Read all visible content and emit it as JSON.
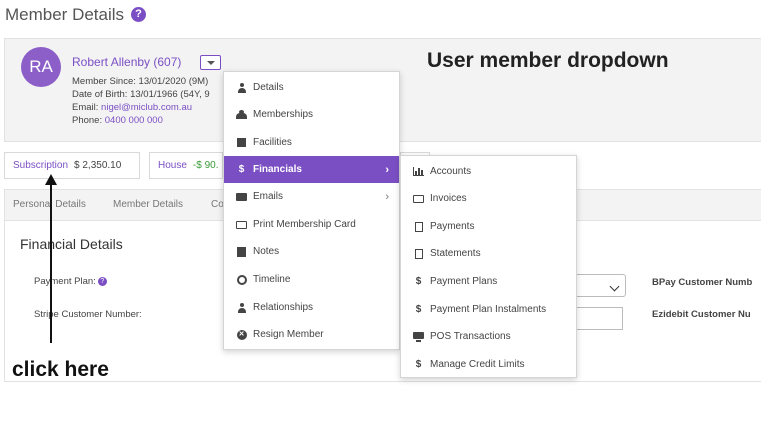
{
  "page": {
    "title": "Member Details",
    "help_glyph": "?"
  },
  "member": {
    "initials": "RA",
    "name": "Robert Allenby (607)",
    "since_label": "Member Since:",
    "since_value": "13/01/2020 (9M)",
    "dob_label": "Date of Birth:",
    "dob_value": "13/01/1966 (54Y, 9",
    "email_label": "Email:",
    "email_value": "nigel@miclub.com.au",
    "phone_label": "Phone:",
    "phone_value": "0400 000 000"
  },
  "annotations": {
    "dropdown_caption": "User member dropdown",
    "click_caption": "click here"
  },
  "balances": [
    {
      "label": "Subscription",
      "amount": "$ 2,350.10"
    },
    {
      "label": "House",
      "amount": "-$ 90."
    }
  ],
  "tabs": [
    "Personal Details",
    "Member Details",
    "Co"
  ],
  "financial": {
    "title": "Financial Details",
    "payment_plan_label": "Payment Plan:",
    "stripe_label": "Stripe Customer Number:",
    "bpay_label": "BPay Customer Numb",
    "ezidebit_label": "Ezidebit Customer Nu"
  },
  "main_menu": [
    {
      "label": "Details",
      "icon": "person-icon"
    },
    {
      "label": "Memberships",
      "icon": "group-icon"
    },
    {
      "label": "Facilities",
      "icon": "puzzle-icon"
    },
    {
      "label": "Financials",
      "icon": "dollar-icon",
      "active": true,
      "submenu": true
    },
    {
      "label": "Emails",
      "icon": "envelope-icon",
      "submenu": true
    },
    {
      "label": "Print Membership Card",
      "icon": "card-icon"
    },
    {
      "label": "Notes",
      "icon": "note-icon"
    },
    {
      "label": "Timeline",
      "icon": "clock-icon"
    },
    {
      "label": "Relationships",
      "icon": "person-icon"
    },
    {
      "label": "Resign Member",
      "icon": "x-circle-icon"
    }
  ],
  "sub_menu": [
    {
      "label": "Accounts",
      "icon": "bar-chart-icon"
    },
    {
      "label": "Invoices",
      "icon": "card-icon"
    },
    {
      "label": "Payments",
      "icon": "document-icon"
    },
    {
      "label": "Statements",
      "icon": "document-icon"
    },
    {
      "label": "Payment Plans",
      "icon": "dollar-icon"
    },
    {
      "label": "Payment Plan Instalments",
      "icon": "dollar-icon"
    },
    {
      "label": "POS Transactions",
      "icon": "monitor-icon"
    },
    {
      "label": "Manage Credit Limits",
      "icon": "dollar-icon"
    }
  ],
  "colors": {
    "accent": "#7b4fc4",
    "positive": "#3a9b3a"
  }
}
